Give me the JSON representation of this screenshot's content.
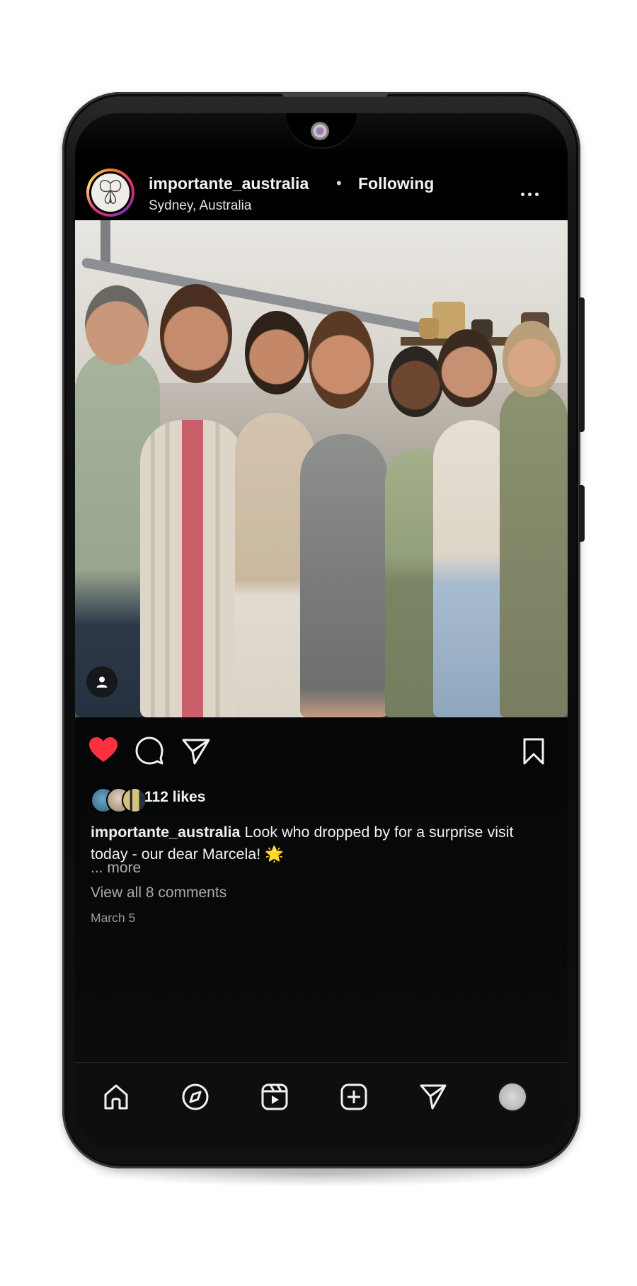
{
  "post": {
    "username": "importante_australia",
    "separator": "•",
    "following_label": "Following",
    "location": "Sydney, Australia"
  },
  "engagement": {
    "likes": "112 likes",
    "liked": true
  },
  "caption": {
    "username": "importante_australia",
    "text": "Look who dropped by for a surprise visit today - our dear Marcela! 🌟",
    "more_label": "... more"
  },
  "comments": {
    "view_all_label": "View all 8 comments"
  },
  "date": "March 5",
  "colors": {
    "like_red": "#ff3040",
    "background": "#000000",
    "text_primary": "#f2f2f2",
    "text_secondary": "#a8a8a8"
  },
  "icons": {
    "header": [
      "more-options-icon"
    ],
    "actions": [
      "heart-icon",
      "comment-icon",
      "share-icon",
      "bookmark-icon"
    ],
    "nav": [
      "home-icon",
      "explore-icon",
      "reels-icon",
      "create-icon",
      "messages-icon",
      "profile-icon"
    ],
    "photo": [
      "user-tag-icon"
    ]
  }
}
